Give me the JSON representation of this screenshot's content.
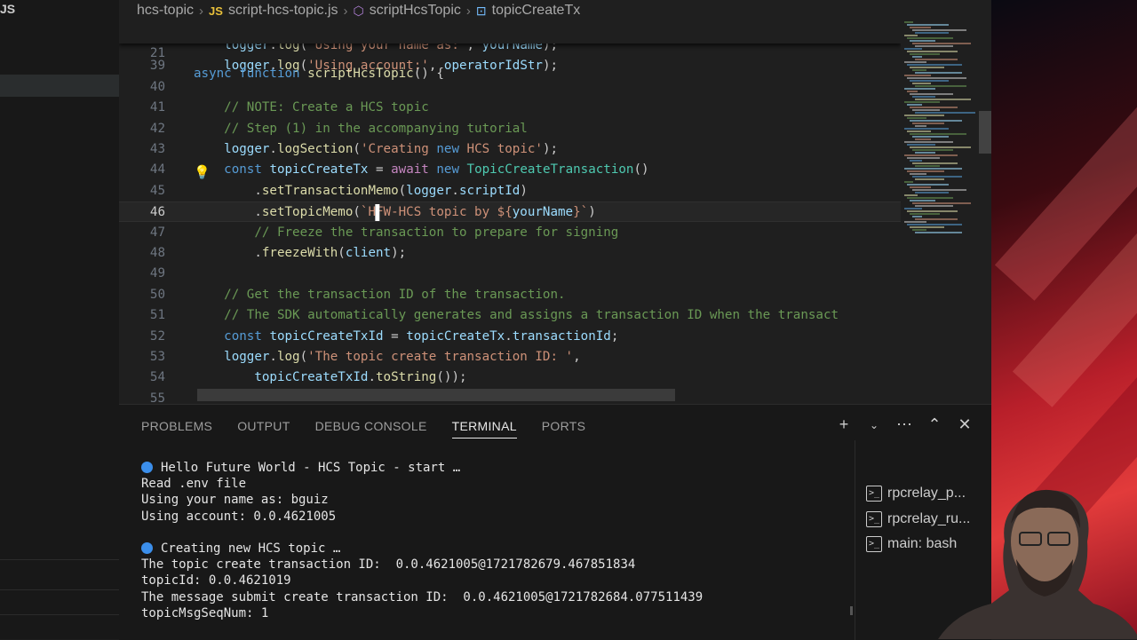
{
  "sidebar": {
    "label": "JS"
  },
  "breadcrumb": [
    "hcs-topic",
    "script-hcs-topic.js",
    "scriptHcsTopic",
    "topicCreateTx"
  ],
  "breadcrumb_icons": {
    "file": "JS",
    "function": "cube-icon",
    "field": "field-icon"
  },
  "code": {
    "sticky": {
      "ln": "21",
      "pre": "async ",
      "kw": "function ",
      "fn": "scriptHcsTopic",
      "rest": "() {"
    },
    "lines": [
      {
        "ln": "",
        "text": "    logger.log('Using your name as:', yourName);"
      },
      {
        "ln": "39",
        "text": "    logger.log('Using account:', operatorIdStr);"
      },
      {
        "ln": "40",
        "text": ""
      },
      {
        "ln": "41",
        "text": "    // NOTE: Create a HCS topic"
      },
      {
        "ln": "42",
        "text": "    // Step (1) in the accompanying tutorial"
      },
      {
        "ln": "43",
        "text": "    logger.logSection('Creating new HCS topic');"
      },
      {
        "ln": "44",
        "text": "    const topicCreateTx = await new TopicCreateTransaction()"
      },
      {
        "ln": "45",
        "text": "        .setTransactionMemo(logger.scriptId)"
      },
      {
        "ln": "46",
        "text": "        .setTopicMemo(`HFW-HCS topic by ${yourName}`)"
      },
      {
        "ln": "47",
        "text": "        // Freeze the transaction to prepare for signing"
      },
      {
        "ln": "48",
        "text": "        .freezeWith(client);"
      },
      {
        "ln": "49",
        "text": ""
      },
      {
        "ln": "50",
        "text": "    // Get the transaction ID of the transaction."
      },
      {
        "ln": "51",
        "text": "    // The SDK automatically generates and assigns a transaction ID when the transact"
      },
      {
        "ln": "52",
        "text": "    const topicCreateTxId = topicCreateTx.transactionId;"
      },
      {
        "ln": "53",
        "text": "    logger.log('The topic create transaction ID: ',"
      },
      {
        "ln": "54",
        "text": "        topicCreateTxId.toString());"
      },
      {
        "ln": "55",
        "text": ""
      }
    ]
  },
  "panel": {
    "tabs": [
      "PROBLEMS",
      "OUTPUT",
      "DEBUG CONSOLE",
      "TERMINAL",
      "PORTS"
    ],
    "active_tab": "TERMINAL"
  },
  "terminal": {
    "lines": [
      {
        "dot": true,
        "text": "Hello Future World - HCS Topic - start …"
      },
      {
        "dot": false,
        "text": "Read .env file"
      },
      {
        "dot": false,
        "text": "Using your name as: bguiz"
      },
      {
        "dot": false,
        "text": "Using account: 0.0.4621005"
      },
      {
        "dot": false,
        "text": ""
      },
      {
        "dot": true,
        "text": "Creating new HCS topic …"
      },
      {
        "dot": false,
        "text": "The topic create transaction ID:  0.0.4621005@1721782679.467851834"
      },
      {
        "dot": false,
        "text": "topicId: 0.0.4621019"
      },
      {
        "dot": false,
        "text": "The message submit create transaction ID:  0.0.4621005@1721782684.077511439"
      },
      {
        "dot": false,
        "text": "topicMsgSeqNum: 1"
      }
    ],
    "sessions": [
      "rpcrelay_p...",
      "rpcrelay_ru...",
      "main: bash"
    ]
  },
  "colors": {
    "accent": "#3b8eea",
    "desktop": "#e23b3b"
  }
}
